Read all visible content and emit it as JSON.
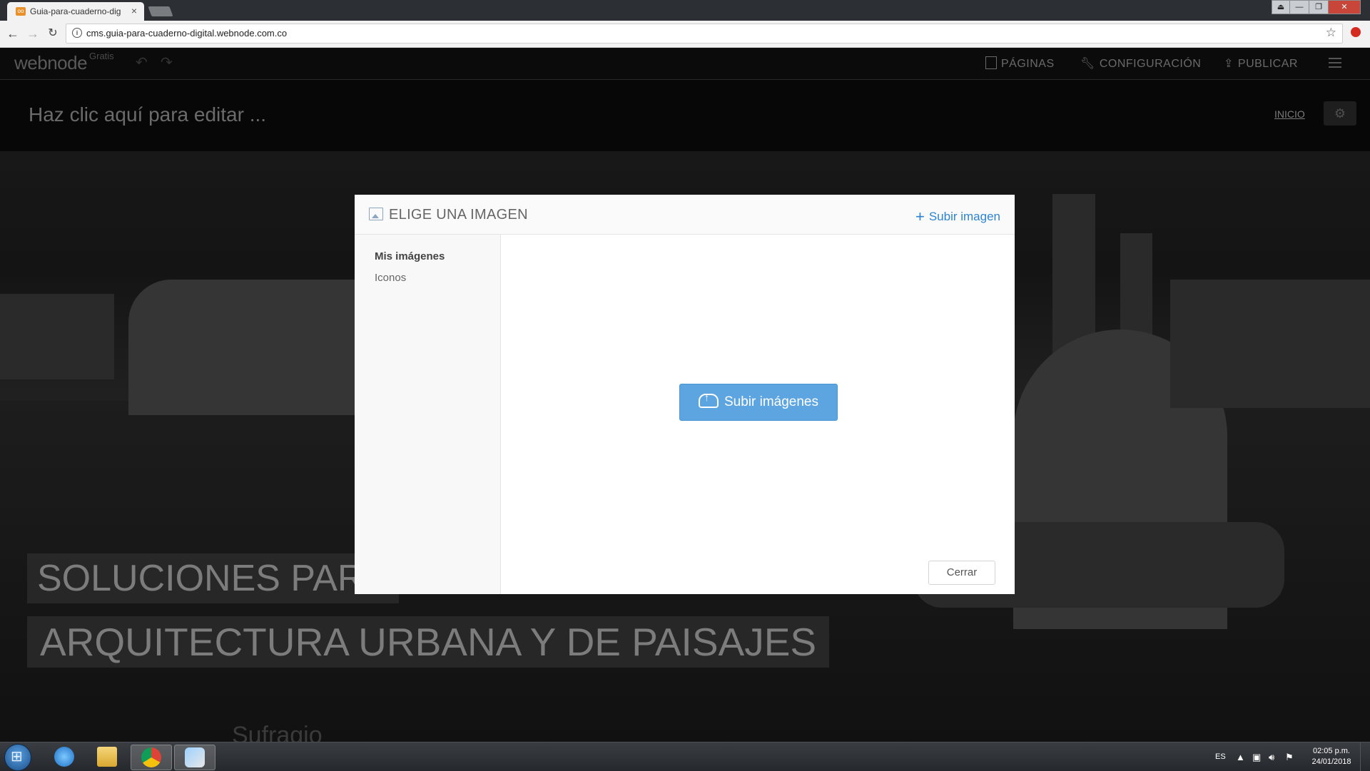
{
  "browser": {
    "tab_title": "Guia-para-cuaderno-dig",
    "url": "cms.guia-para-cuaderno-digital.webnode.com.co"
  },
  "webnode": {
    "logo": "webnode",
    "plan": "Gratis",
    "menu": {
      "pages": "PÁGINAS",
      "settings": "CONFIGURACIÓN",
      "publish": "PUBLICAR"
    }
  },
  "site": {
    "title": "Haz clic aquí para editar ...",
    "nav_home": "INICIO",
    "hero_line1": "SOLUCIONES PARA",
    "hero_line2": "ARQUITECTURA URBANA Y DE PAISAJES",
    "hero_faded": "Sufragio"
  },
  "modal": {
    "title": "ELIGE UNA IMAGEN",
    "upload_link": "Subir imagen",
    "sidebar": [
      {
        "label": "Mis imágenes",
        "active": true
      },
      {
        "label": "Iconos",
        "active": false
      }
    ],
    "upload_button": "Subir imágenes",
    "close_button": "Cerrar"
  },
  "taskbar": {
    "language": "ES",
    "time": "02:05 p.m.",
    "date": "24/01/2018"
  }
}
